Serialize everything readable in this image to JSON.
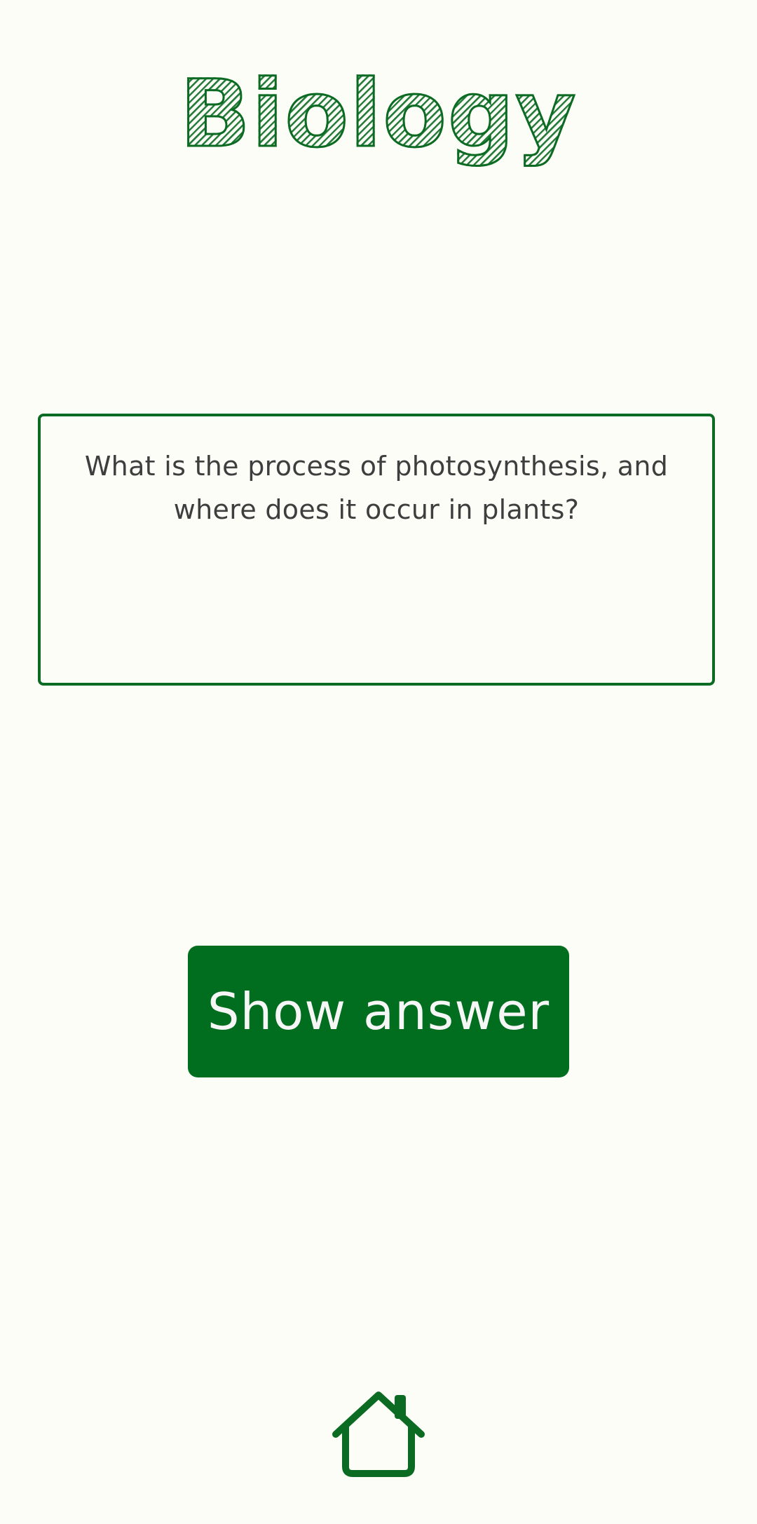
{
  "header": {
    "title": "Biology"
  },
  "card": {
    "question": "What is the process of photosynthesis, and where does it occur in plants?"
  },
  "actions": {
    "show_answer_label": "Show answer"
  },
  "nav": {
    "home_icon": "home-icon"
  },
  "colors": {
    "accent": "#0B6B23",
    "button_bg": "#006E1E",
    "background": "#FCFDF7",
    "question_text": "#3E3E3E"
  }
}
